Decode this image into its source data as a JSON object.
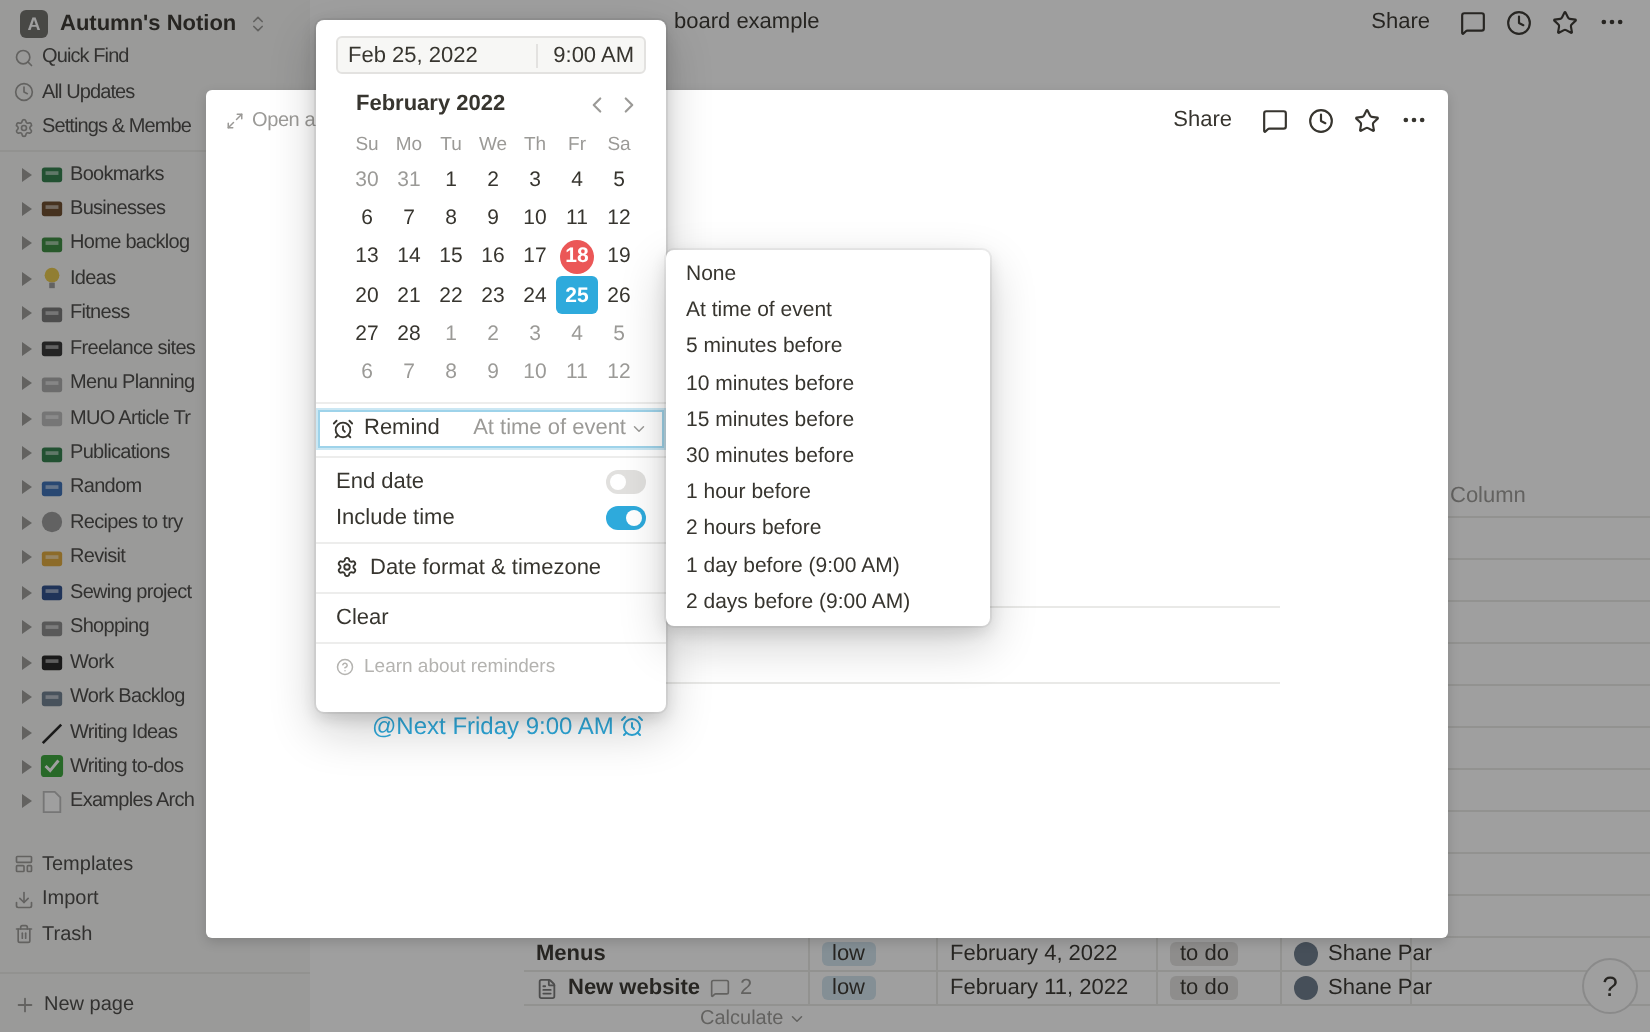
{
  "sidebar": {
    "workspace": {
      "initial": "A",
      "name": "Autumn's Notion"
    },
    "nav": [
      {
        "label": "Quick Find",
        "kind": "search"
      },
      {
        "label": "All Updates",
        "kind": "clock"
      },
      {
        "label": "Settings & Membe",
        "kind": "gear"
      }
    ],
    "pages": [
      "Bookmarks",
      "Businesses",
      "Home backlog",
      "Ideas",
      "Fitness",
      "Freelance sites",
      "Menu Planning",
      "MUO Article Tr",
      "Publications",
      "Random",
      "Recipes to try",
      "Revisit",
      "Sewing project",
      "Shopping",
      "Work",
      "Work Backlog",
      "Writing Ideas",
      "Writing to-dos",
      "Examples Arch"
    ],
    "tools": [
      {
        "label": "Templates",
        "kind": "templates"
      },
      {
        "label": "Import",
        "kind": "import"
      },
      {
        "label": "Trash",
        "kind": "trash"
      }
    ],
    "new_page": "New page"
  },
  "topbar": {
    "breadcrumb": "board example",
    "share": "Share"
  },
  "table": {
    "header": "Column",
    "rows": [
      {
        "name": "Menus",
        "priority": "low",
        "date": "February 4, 2022",
        "status": "to do",
        "assignee": "Shane Par"
      },
      {
        "name": "New website",
        "comments": "2",
        "priority": "low",
        "date": "February 11, 2022",
        "status": "to do",
        "assignee": "Shane Par"
      }
    ],
    "calculate": "Calculate"
  },
  "help_button": "?",
  "modal": {
    "open_as": "Open a",
    "share": "Share",
    "mention": "@Next Friday 9:00 AM"
  },
  "date_popup": {
    "date": "Feb 25, 2022",
    "time": "9:00 AM",
    "month": "February 2022",
    "weekdays": [
      "Su",
      "Mo",
      "Tu",
      "We",
      "Th",
      "Fr",
      "Sa"
    ],
    "weeks": [
      [
        {
          "day": "30",
          "in_month": false,
          "today": false,
          "selected": false
        },
        {
          "day": "31",
          "in_month": false,
          "today": false,
          "selected": false
        },
        {
          "day": "1",
          "in_month": true,
          "today": false,
          "selected": false
        },
        {
          "day": "2",
          "in_month": true,
          "today": false,
          "selected": false
        },
        {
          "day": "3",
          "in_month": true,
          "today": false,
          "selected": false
        },
        {
          "day": "4",
          "in_month": true,
          "today": false,
          "selected": false
        },
        {
          "day": "5",
          "in_month": true,
          "today": false,
          "selected": false
        }
      ],
      [
        {
          "day": "6",
          "in_month": true,
          "today": false,
          "selected": false
        },
        {
          "day": "7",
          "in_month": true,
          "today": false,
          "selected": false
        },
        {
          "day": "8",
          "in_month": true,
          "today": false,
          "selected": false
        },
        {
          "day": "9",
          "in_month": true,
          "today": false,
          "selected": false
        },
        {
          "day": "10",
          "in_month": true,
          "today": false,
          "selected": false
        },
        {
          "day": "11",
          "in_month": true,
          "today": false,
          "selected": false
        },
        {
          "day": "12",
          "in_month": true,
          "today": false,
          "selected": false
        }
      ],
      [
        {
          "day": "13",
          "in_month": true,
          "today": false,
          "selected": false
        },
        {
          "day": "14",
          "in_month": true,
          "today": false,
          "selected": false
        },
        {
          "day": "15",
          "in_month": true,
          "today": false,
          "selected": false
        },
        {
          "day": "16",
          "in_month": true,
          "today": false,
          "selected": false
        },
        {
          "day": "17",
          "in_month": true,
          "today": false,
          "selected": false
        },
        {
          "day": "18",
          "in_month": true,
          "today": true,
          "selected": false
        },
        {
          "day": "19",
          "in_month": true,
          "today": false,
          "selected": false
        }
      ],
      [
        {
          "day": "20",
          "in_month": true,
          "today": false,
          "selected": false
        },
        {
          "day": "21",
          "in_month": true,
          "today": false,
          "selected": false
        },
        {
          "day": "22",
          "in_month": true,
          "today": false,
          "selected": false
        },
        {
          "day": "23",
          "in_month": true,
          "today": false,
          "selected": false
        },
        {
          "day": "24",
          "in_month": true,
          "today": false,
          "selected": false
        },
        {
          "day": "25",
          "in_month": true,
          "today": false,
          "selected": true
        },
        {
          "day": "26",
          "in_month": true,
          "today": false,
          "selected": false
        }
      ],
      [
        {
          "day": "27",
          "in_month": true,
          "today": false,
          "selected": false
        },
        {
          "day": "28",
          "in_month": true,
          "today": false,
          "selected": false
        },
        {
          "day": "1",
          "in_month": false,
          "today": false,
          "selected": false
        },
        {
          "day": "2",
          "in_month": false,
          "today": false,
          "selected": false
        },
        {
          "day": "3",
          "in_month": false,
          "today": false,
          "selected": false
        },
        {
          "day": "4",
          "in_month": false,
          "today": false,
          "selected": false
        },
        {
          "day": "5",
          "in_month": false,
          "today": false,
          "selected": false
        }
      ],
      [
        {
          "day": "6",
          "in_month": false,
          "today": false,
          "selected": false
        },
        {
          "day": "7",
          "in_month": false,
          "today": false,
          "selected": false
        },
        {
          "day": "8",
          "in_month": false,
          "today": false,
          "selected": false
        },
        {
          "day": "9",
          "in_month": false,
          "today": false,
          "selected": false
        },
        {
          "day": "10",
          "in_month": false,
          "today": false,
          "selected": false
        },
        {
          "day": "11",
          "in_month": false,
          "today": false,
          "selected": false
        },
        {
          "day": "12",
          "in_month": false,
          "today": false,
          "selected": false
        }
      ]
    ],
    "remind": {
      "label": "Remind",
      "value": "At time of event",
      "focused": true
    },
    "toggles": [
      {
        "label": "End date",
        "on": false
      },
      {
        "label": "Include time",
        "on": true
      }
    ],
    "date_format": "Date format & timezone",
    "clear": "Clear",
    "help": "Learn about reminders"
  },
  "reminder_menu": {
    "options": [
      {
        "label": "None",
        "selected": false
      },
      {
        "label": "At time of event",
        "selected": false
      },
      {
        "label": "5 minutes before",
        "selected": false
      },
      {
        "label": "10 minutes before",
        "selected": false
      },
      {
        "label": "15 minutes before",
        "selected": false
      },
      {
        "label": "30 minutes before",
        "selected": false
      },
      {
        "label": "1 hour before",
        "selected": false
      },
      {
        "label": "2 hours before",
        "selected": false
      },
      {
        "label": "1 day before (9:00 AM)",
        "selected": false
      },
      {
        "label": "2 days before (9:00 AM)",
        "selected": false
      }
    ]
  }
}
